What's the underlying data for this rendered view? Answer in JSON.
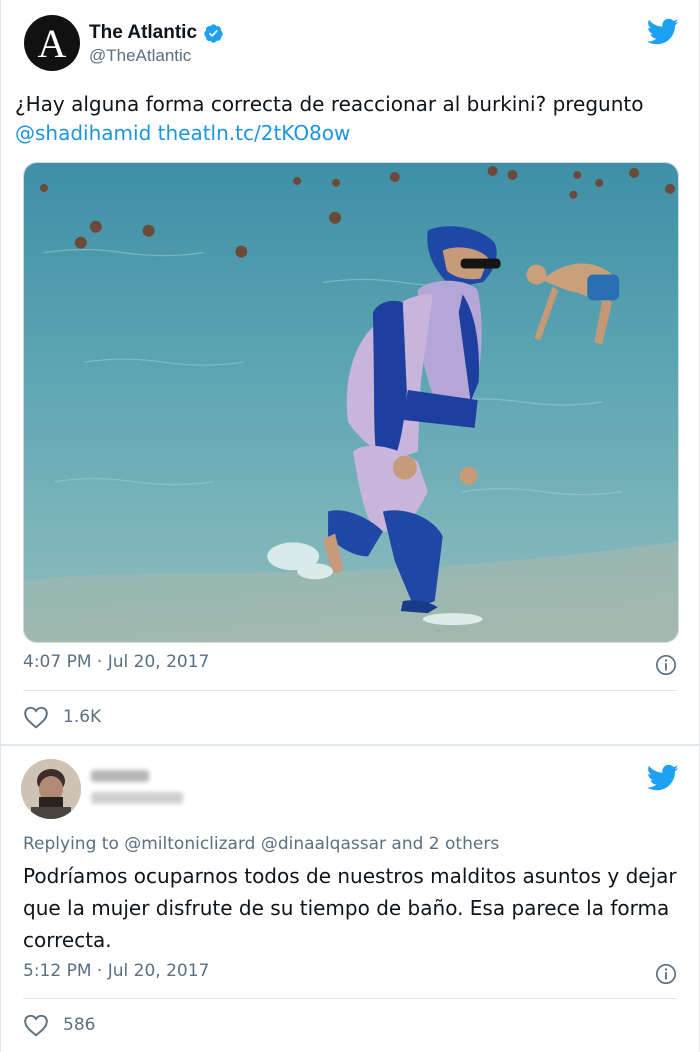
{
  "tweet1": {
    "display_name": "The Atlantic",
    "handle": "@TheAtlantic",
    "avatar_letter": "A",
    "text_main": "¿Hay alguna forma correcta de reaccionar al burkini? pregunto",
    "text_mention": "@shadihamid",
    "text_link": "theatln.tc/2tKO8ow",
    "timestamp": "4:07 PM · Jul 20, 2017",
    "likes": "1.6K",
    "icons": [
      "verified-badge-icon",
      "twitter-bird-icon",
      "info-icon",
      "heart-icon"
    ]
  },
  "tweet2": {
    "reply_prefix": "Replying to",
    "reply_mentions": "@miltoniclizard @dinaalqassar",
    "reply_others": "and 2 others",
    "text": "Podríamos ocuparnos todos de nuestros malditos asuntos y dejar que la mujer disfrute de su tiempo de baño. Esa parece la forma correcta.",
    "timestamp": "5:12 PM · Jul 20, 2017",
    "likes": "586",
    "icons": [
      "twitter-bird-icon",
      "info-icon",
      "heart-icon"
    ]
  },
  "colors": {
    "link": "#1b95e0",
    "muted": "#5b7083",
    "text": "#0f1419",
    "twitter_blue": "#1da1f2"
  }
}
